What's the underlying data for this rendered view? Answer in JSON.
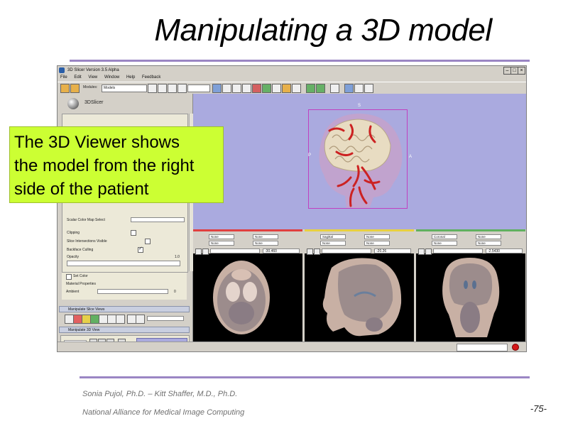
{
  "slide": {
    "title": "Manipulating a 3D model",
    "callout_lines": [
      "The 3D Viewer shows",
      "the model from the right",
      "side of the patient"
    ],
    "footer_authors": "Sonia Pujol, Ph.D. – Kitt Shaffer, M.D., Ph.D.",
    "footer_org": "National Alliance for Medical Image Computing",
    "page_number": "-75-",
    "colors": {
      "rule": "#9b86c4",
      "callout_bg": "#ccff33",
      "viewer_bg": "#aaaadf"
    }
  },
  "app": {
    "window_title": "3D Slicer Version 3.5 Alpha",
    "menu": [
      "File",
      "Edit",
      "View",
      "Window",
      "Help",
      "Feedback"
    ],
    "toolbar": {
      "modules_label": "Modules:",
      "module_select": "Models"
    },
    "module_panel": {
      "logo_text": "3DSlicer",
      "properties": [
        {
          "label": "Scalar Color Map Select",
          "type": "select"
        },
        {
          "label": "Clipping",
          "type": "checkbox",
          "checked": false
        },
        {
          "label": "Slice Intersections Visible",
          "type": "checkbox",
          "checked": false
        },
        {
          "label": "Backface Culling",
          "type": "checkbox",
          "checked": true
        },
        {
          "label": "Opacity",
          "type": "slider",
          "value": "1.0"
        },
        {
          "label": "Set Color",
          "type": "button"
        },
        {
          "label": "Material Properties",
          "type": "section"
        },
        {
          "label": "Ambient",
          "type": "slider",
          "value": "0"
        }
      ],
      "section_slice_views": "Manipulate Slice Views",
      "section_3d_view": "Manipulate 3D View"
    },
    "viewer3d": {
      "orientation_labels": {
        "superior": "S",
        "anterior": "A",
        "posterior": "P"
      },
      "icons": [
        "head-surface-model",
        "brain-surface-model",
        "vessel-model"
      ]
    },
    "slice_views": [
      {
        "name": "Red",
        "orientation": "Axial",
        "accent": "#e04040",
        "offset": "-30.460",
        "row1a": "None",
        "row1b": "None",
        "row2a": "None",
        "row2b": "None"
      },
      {
        "name": "Yellow",
        "orientation": "Sagittal",
        "accent": "#e8d040",
        "offset": "-20.26",
        "row1a": "None",
        "row1b": "None",
        "row2a": "None",
        "row2b": "None"
      },
      {
        "name": "Green",
        "orientation": "Coronal",
        "accent": "#60b060",
        "offset": "-2.5430",
        "row1a": "None",
        "row1b": "None",
        "row2a": "None",
        "row2b": "None"
      }
    ]
  }
}
